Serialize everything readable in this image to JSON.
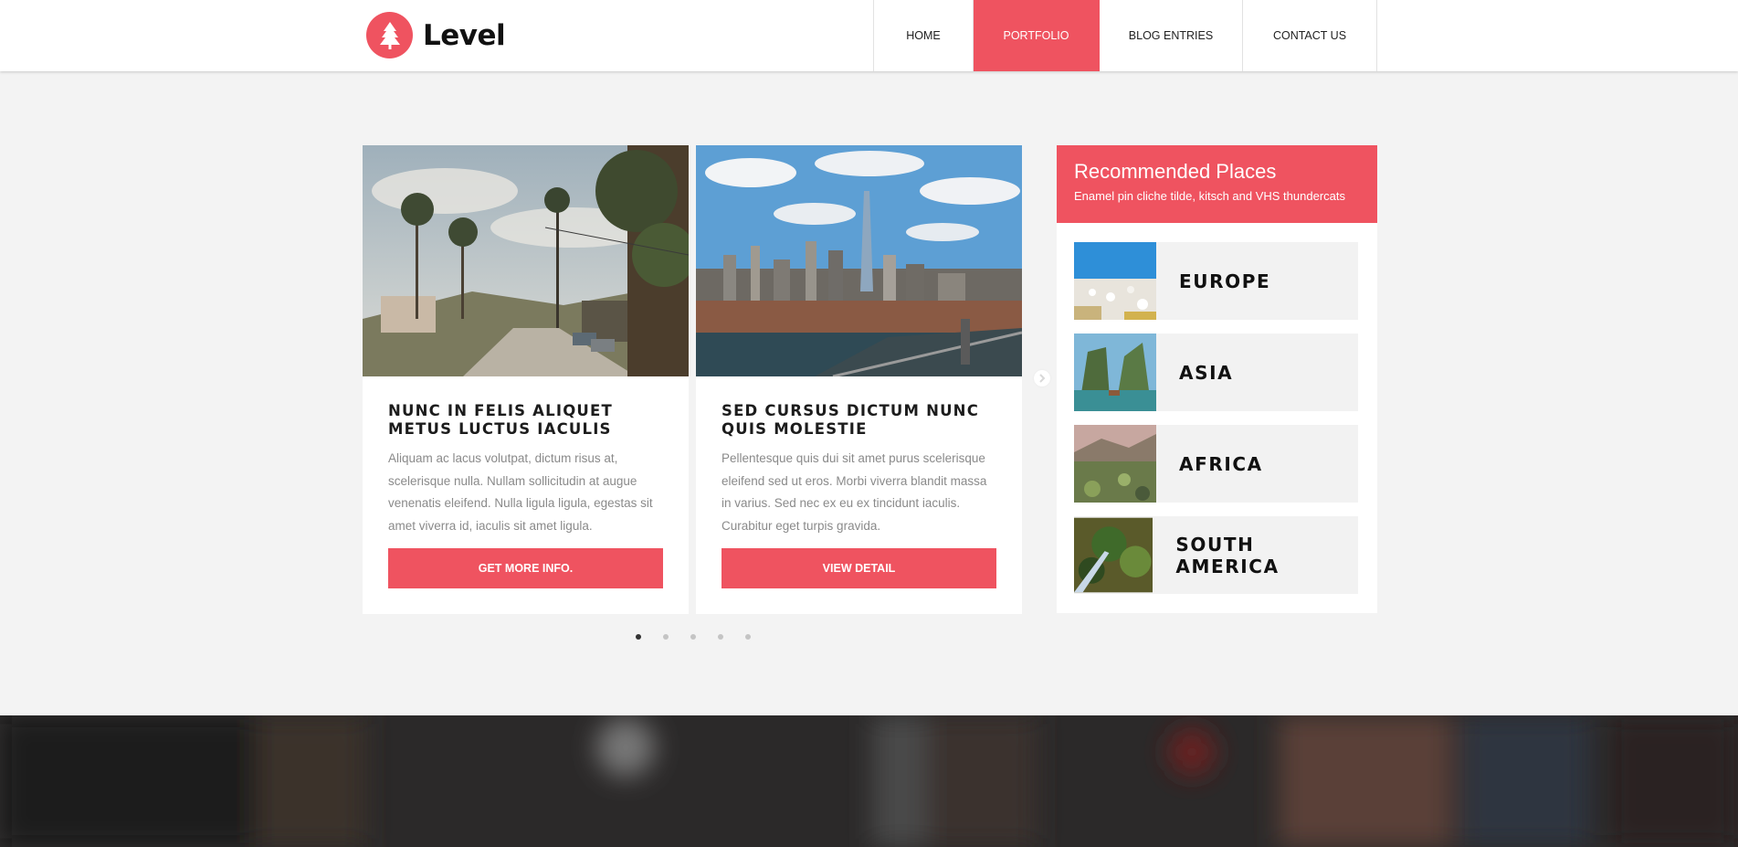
{
  "brand": {
    "name": "Level",
    "accent": "#ef5360"
  },
  "nav": {
    "items": [
      {
        "label": "HOME",
        "active": false
      },
      {
        "label": "PORTFOLIO",
        "active": true
      },
      {
        "label": "BLOG ENTRIES",
        "active": false
      },
      {
        "label": "CONTACT US",
        "active": false
      }
    ]
  },
  "carousel": {
    "cards": [
      {
        "title": "NUNC IN FELIS ALIQUET METUS LUCTUS IACULIS",
        "text": "Aliquam ac lacus volutpat, dictum risus at, scelerisque nulla. Nullam sollicitudin at augue venenatis eleifend. Nulla ligula ligula, egestas sit amet viverra id, iaculis sit amet ligula.",
        "button": "GET MORE INFO.",
        "image": "palm-tree-street-photo"
      },
      {
        "title": "SED CURSUS DICTUM NUNC QUIS MOLESTIE",
        "text": "Pellentesque quis dui sit amet purus scelerisque eleifend sed ut eros. Morbi viverra blandit massa in varius. Sed nec ex eu ex tincidunt iaculis. Curabitur eget turpis gravida.",
        "button": "VIEW DETAIL",
        "image": "city-skyline-bridge-photo"
      }
    ],
    "dots": {
      "count": 5,
      "active_index": 0
    },
    "next_icon": "chevron-right-icon"
  },
  "sidebar": {
    "title": "Recommended Places",
    "subtitle": "Enamel pin cliche tilde, kitsch and VHS thundercats",
    "places": [
      {
        "name": "EUROPE",
        "thumb": "europe-thumb"
      },
      {
        "name": "ASIA",
        "thumb": "asia-thumb"
      },
      {
        "name": "AFRICA",
        "thumb": "africa-thumb"
      },
      {
        "name": "SOUTH AMERICA",
        "thumb": "south-america-thumb"
      }
    ]
  }
}
